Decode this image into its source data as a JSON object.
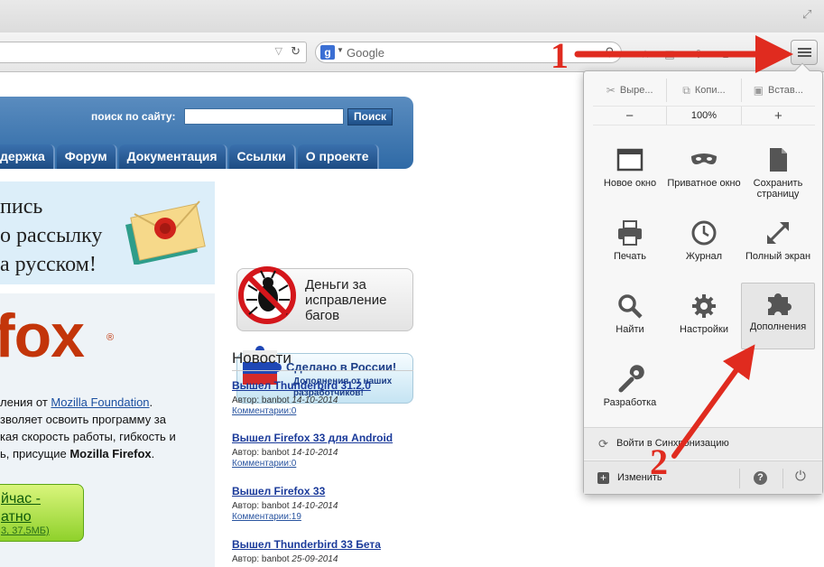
{
  "browser": {
    "search_placeholder": "Google",
    "search_engine_letter": "g"
  },
  "site": {
    "search_label": "поиск по сайту:",
    "search_button": "Поиск",
    "nav": [
      "держка",
      "Форум",
      "Документация",
      "Ссылки",
      "О проекте"
    ]
  },
  "promo": {
    "lines": [
      "пись",
      "о рассылку",
      "а русском!"
    ]
  },
  "firefox": {
    "logo": "fox",
    "reg": "®",
    "desc_prefix": "ления от ",
    "desc_link": "Mozilla Foundation",
    "desc_line1_end": ".",
    "desc_line2": "зволяет освоить программу за",
    "desc_line3": "кая скорость работы, гибкость и",
    "desc_line4_prefix": "ь, присущие ",
    "desc_line4_bold": "Mozilla Firefox",
    "desc_line4_end": ".",
    "download_line1": "йчас -",
    "download_line2": "атно",
    "download_size": "3, 37,5МБ)"
  },
  "badges": {
    "bugs_text": "Деньги за исправление багов",
    "bugs_line1": "Деньги за",
    "bugs_line2": "исправление",
    "bugs_line3": "багов",
    "ru_title": "Сделано в России!",
    "ru_sub": "Дополнения от наших разработчиков!"
  },
  "news": {
    "title": "Новости",
    "items": [
      {
        "title": "Вышел Thunderbird 31.2.0",
        "author_label": "Автор: banbot",
        "date": "14-10-2014",
        "comments": "Комментарии:0"
      },
      {
        "title": "Вышел Firefox 33 для Android",
        "author_label": "Автор: banbot",
        "date": "14-10-2014",
        "comments": "Комментарии:0"
      },
      {
        "title": "Вышел Firefox 33",
        "author_label": "Автор: banbot",
        "date": "14-10-2014",
        "comments": "Комментарии:19"
      },
      {
        "title": "Вышел Thunderbird 33 Бета",
        "author_label": "Автор: banbot",
        "date": "25-09-2014",
        "comments": ""
      }
    ]
  },
  "menu": {
    "cut": "Выре...",
    "copy": "Копи...",
    "paste": "Встав...",
    "zoom_out": "−",
    "zoom_level": "100%",
    "zoom_in": "+",
    "items": [
      {
        "label": "Новое окно",
        "icon": "new-window-icon"
      },
      {
        "label": "Приватное окно",
        "icon": "private-window-icon"
      },
      {
        "label": "Сохранить страницу",
        "icon": "save-page-icon"
      },
      {
        "label": "Печать",
        "icon": "print-icon"
      },
      {
        "label": "Журнал",
        "icon": "history-icon"
      },
      {
        "label": "Полный экран",
        "icon": "fullscreen-icon"
      },
      {
        "label": "Найти",
        "icon": "search-icon"
      },
      {
        "label": "Настройки",
        "icon": "settings-icon"
      },
      {
        "label": "Дополнения",
        "icon": "addons-icon"
      },
      {
        "label": "Разработка",
        "icon": "developer-icon"
      }
    ],
    "sync": "Войти в Синхронизацию",
    "customize": "Изменить"
  },
  "annotations": {
    "step1": "1",
    "step2": "2",
    "arrow_color": "#e02b1f"
  },
  "colors": {
    "site_nav": "#2a5d96",
    "firefox_orange": "#c3350a",
    "link_blue": "#1a3a9a"
  }
}
